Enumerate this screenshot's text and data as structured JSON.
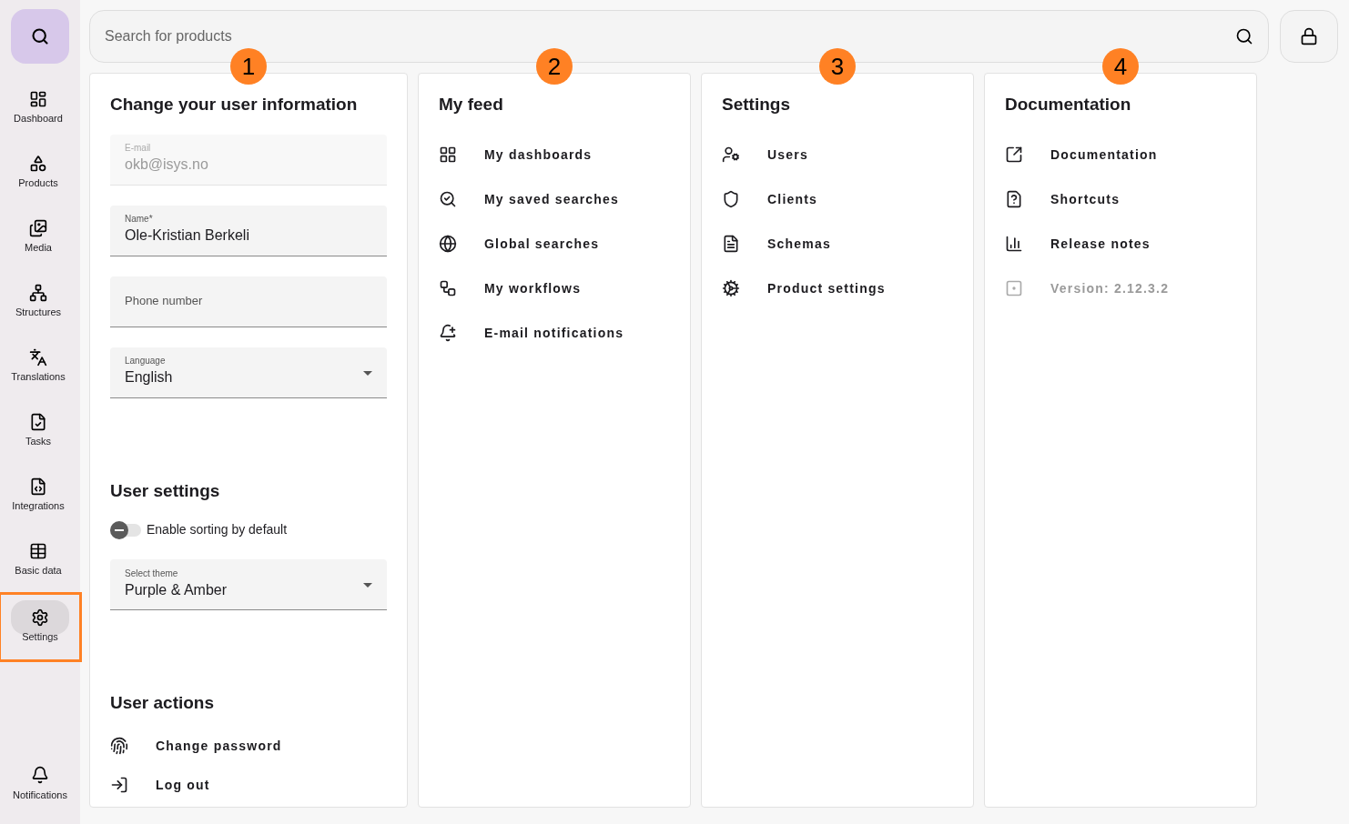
{
  "sidebar": {
    "items": [
      {
        "label": "Dashboard",
        "selected": false,
        "highlighted": false
      },
      {
        "label": "Products",
        "selected": false,
        "highlighted": false
      },
      {
        "label": "Media",
        "selected": false,
        "highlighted": false
      },
      {
        "label": "Structures",
        "selected": false,
        "highlighted": false
      },
      {
        "label": "Translations",
        "selected": false,
        "highlighted": false
      },
      {
        "label": "Tasks",
        "selected": false,
        "highlighted": false
      },
      {
        "label": "Integrations",
        "selected": false,
        "highlighted": false
      },
      {
        "label": "Basic data",
        "selected": false,
        "highlighted": false
      },
      {
        "label": "Settings",
        "selected": true,
        "highlighted": true
      }
    ],
    "bottom_item": {
      "label": "Notifications",
      "selected": false
    }
  },
  "search": {
    "placeholder": "Search for products"
  },
  "user_card": {
    "callout": "1",
    "title": "Change your user information",
    "fields": [
      {
        "kind": "text",
        "label": "E-mail",
        "value": "okb@isys.no",
        "disabled": true
      },
      {
        "kind": "text",
        "label": "Name*",
        "value": "Ole-Kristian Berkeli",
        "disabled": false
      },
      {
        "kind": "text",
        "placeholder": "Phone number",
        "disabled": false
      },
      {
        "kind": "select",
        "label": "Language",
        "value": "English",
        "disabled": false
      }
    ],
    "settings_title": "User settings",
    "toggle": {
      "label": "Enable sorting by default",
      "on": false
    },
    "theme": {
      "kind": "select",
      "label": "Select theme",
      "value": "Purple & Amber",
      "disabled": false
    },
    "actions_title": "User actions",
    "actions": [
      {
        "label": "Change password"
      },
      {
        "label": "Log out"
      }
    ]
  },
  "cards": [
    {
      "callout": "2",
      "title": "My feed",
      "items": [
        {
          "label": "My dashboards",
          "disabled": false
        },
        {
          "label": "My saved searches",
          "disabled": false
        },
        {
          "label": "Global searches",
          "disabled": false
        },
        {
          "label": "My workflows",
          "disabled": false
        },
        {
          "label": "E-mail notifications",
          "disabled": false
        }
      ]
    },
    {
      "callout": "3",
      "title": "Settings",
      "items": [
        {
          "label": "Users",
          "disabled": false
        },
        {
          "label": "Clients",
          "disabled": false
        },
        {
          "label": "Schemas",
          "disabled": false
        },
        {
          "label": "Product settings",
          "disabled": false
        }
      ]
    },
    {
      "callout": "4",
      "title": "Documentation",
      "items": [
        {
          "label": "Documentation",
          "disabled": false
        },
        {
          "label": "Shortcuts",
          "disabled": false
        },
        {
          "label": "Release notes",
          "disabled": false
        },
        {
          "label": "Version: 2.12.3.2",
          "disabled": true
        }
      ]
    }
  ]
}
